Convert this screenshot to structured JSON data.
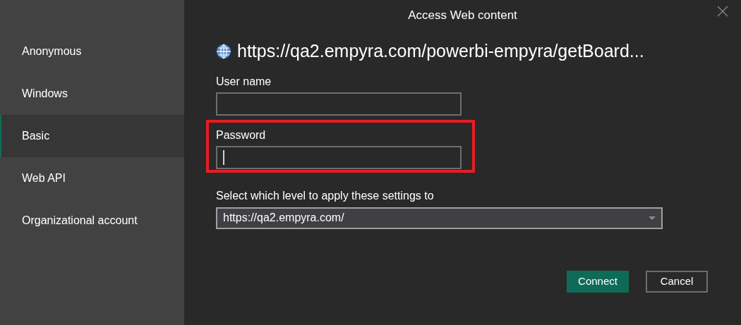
{
  "sidebar": {
    "items": [
      {
        "label": "Anonymous",
        "selected": false
      },
      {
        "label": "Windows",
        "selected": false
      },
      {
        "label": "Basic",
        "selected": true
      },
      {
        "label": "Web API",
        "selected": false
      },
      {
        "label": "Organizational account",
        "selected": false
      }
    ]
  },
  "dialog": {
    "title": "Access Web content",
    "url": "https://qa2.empyra.com/powerbi-empyra/getBoard...",
    "fields": [
      {
        "label": "User name",
        "focused": false,
        "highlighted": false
      },
      {
        "label": "Password",
        "focused": true,
        "highlighted": true
      }
    ],
    "level": {
      "label": "Select which level to apply these settings to",
      "value": "https://qa2.empyra.com/"
    },
    "buttons": [
      {
        "label": "Connect",
        "kind": "primary"
      },
      {
        "label": "Cancel",
        "kind": "secondary"
      }
    ]
  }
}
